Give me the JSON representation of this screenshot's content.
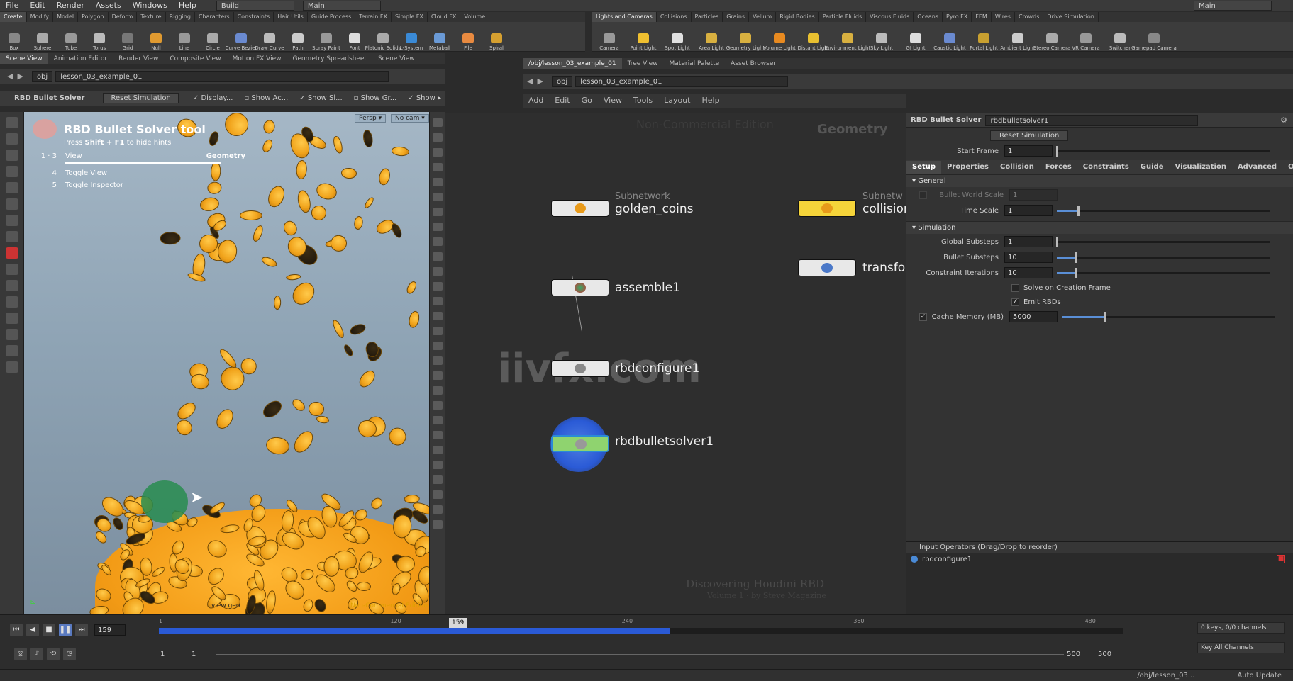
{
  "menubar": {
    "items": [
      "File",
      "Edit",
      "Render",
      "Assets",
      "Windows",
      "Help"
    ],
    "desktop_left": "Build",
    "desktop_center": "Main",
    "desktop_right": "Main"
  },
  "shelf_left": {
    "tabs": [
      "Create",
      "Modify",
      "Model",
      "Polygon",
      "Deform",
      "Texture",
      "Rigging",
      "Characters",
      "Constraints",
      "Hair Utils",
      "Guide Process",
      "Terrain FX",
      "Simple FX",
      "Cloud FX",
      "Volume"
    ],
    "tools": [
      "Box",
      "Sphere",
      "Tube",
      "Torus",
      "Grid",
      "Null",
      "Line",
      "Circle",
      "Curve Bezier",
      "Draw Curve",
      "Path",
      "Spray Paint",
      "Font",
      "Platonic Solids",
      "L-System",
      "Metaball",
      "File",
      "Spiral"
    ]
  },
  "shelf_right": {
    "tabs": [
      "Lights and Cameras",
      "Collisions",
      "Particles",
      "Grains",
      "Vellum",
      "Rigid Bodies",
      "Particle Fluids",
      "Viscous Fluids",
      "Oceans",
      "Pyro FX",
      "FEM",
      "Wires",
      "Crowds",
      "Drive Simulation"
    ],
    "tools": [
      "Camera",
      "Point Light",
      "Spot Light",
      "Area Light",
      "Geometry Light",
      "Volume Light",
      "Distant Light",
      "Environment Light",
      "Sky Light",
      "GI Light",
      "Caustic Light",
      "Portal Light",
      "Ambient Light",
      "Stereo Camera",
      "VR Camera",
      "Switcher",
      "Gamepad Camera"
    ]
  },
  "left_pane": {
    "tabs": [
      "Scene View",
      "Animation Editor",
      "Render View",
      "Composite View",
      "Motion FX View",
      "Geometry Spreadsheet",
      "Scene View"
    ],
    "path_root": "obj",
    "path_node": "lesson_03_example_01",
    "tool_name": "RBD Bullet Solver",
    "reset_button": "Reset Simulation",
    "toggles": [
      "Display...",
      "Show Ac...",
      "Show Sl...",
      "Show Gr...",
      "Show"
    ],
    "hint_title": "RBD Bullet Solver tool",
    "hint_sub_prefix": "Press ",
    "hint_sub_key": "Shift + F1",
    "hint_sub_suffix": " to hide hints",
    "hint_rows": [
      {
        "num": "1 · 3",
        "label": "View"
      },
      {
        "num": "4",
        "label": "Toggle View"
      },
      {
        "num": "5",
        "label": "Toggle Inspector"
      }
    ],
    "hint_right": "Geometry",
    "persp": "Persp",
    "cam": "No cam",
    "view_label": "view geo",
    "watermark_small": "Non-Commercial Edition"
  },
  "network": {
    "tabs": [
      "/obj/lesson_03_example_01",
      "Tree View",
      "Material Palette",
      "Asset Browser"
    ],
    "path_root": "obj",
    "path_node": "lesson_03_example_01",
    "menu": [
      "Add",
      "Edit",
      "Go",
      "View",
      "Tools",
      "Layout",
      "Help"
    ],
    "bg_edition": "Non-Commercial Edition",
    "bg_context": "Geometry",
    "watermark": "iivfx.com",
    "credit_title": "Discovering Houdini RBD",
    "credit_sub": "Volume 1 · by Steve Magazine",
    "nodes": {
      "golden_coins": {
        "type": "Subnetwork",
        "name": "golden_coins"
      },
      "collision": {
        "type": "Subnetw",
        "name": "collision"
      },
      "assemble": {
        "name": "assemble1"
      },
      "transform": {
        "name": "transfor"
      },
      "rbdconfigure": {
        "name": "rbdconfigure1"
      },
      "solver": {
        "name": "rbdbulletsolver1"
      }
    }
  },
  "params": {
    "node_type": "RBD Bullet Solver",
    "node_name": "rbdbulletsolver1",
    "reset_button": "Reset Simulation",
    "start_frame_label": "Start Frame",
    "start_frame": "1",
    "start_frame_frac": 0.0,
    "tabs": [
      "Setup",
      "Properties",
      "Collision",
      "Forces",
      "Constraints",
      "Guide",
      "Visualization",
      "Advanced",
      "Output"
    ],
    "general_section": "General",
    "bullet_world_scale_label": "Bullet World Scale",
    "bullet_world_scale": "1",
    "time_scale_label": "Time Scale",
    "time_scale": "1",
    "time_scale_frac": 0.1,
    "simulation_section": "Simulation",
    "global_substeps_label": "Global Substeps",
    "global_substeps": "1",
    "global_substeps_frac": 0.0,
    "bullet_substeps_label": "Bullet Substeps",
    "bullet_substeps": "10",
    "bullet_substeps_frac": 0.09,
    "constraint_iterations_label": "Constraint Iterations",
    "constraint_iterations": "10",
    "constraint_iterations_frac": 0.09,
    "solve_on_creation_label": "Solve on Creation Frame",
    "emit_rbds_label": "Emit RBDs",
    "cache_memory_label": "Cache Memory (MB)",
    "cache_memory": "5000",
    "cache_memory_frac": 0.2,
    "input_ops_label": "Input Operators (Drag/Drop to reorder)",
    "input_op": "rbdconfigure1"
  },
  "timeline": {
    "current_frame": "159",
    "marker_frame": "159",
    "ticks": [
      "1",
      "120",
      "240",
      "360",
      "480"
    ],
    "cached_frac": 0.53,
    "marker_frac": 0.31,
    "range_start": "1",
    "range_start2": "1",
    "range_end": "500",
    "range_end2": "500",
    "keys_info": "0 keys, 0/0 channels",
    "key_all": "Key All Channels",
    "status_path": "/obj/lesson_03...",
    "auto_update": "Auto Update"
  },
  "colors": {
    "coin": "#f2a41c",
    "solver_node": "#8fd36f",
    "collision_node": "#f5d43a",
    "accent_blue": "#2a5ad6"
  }
}
